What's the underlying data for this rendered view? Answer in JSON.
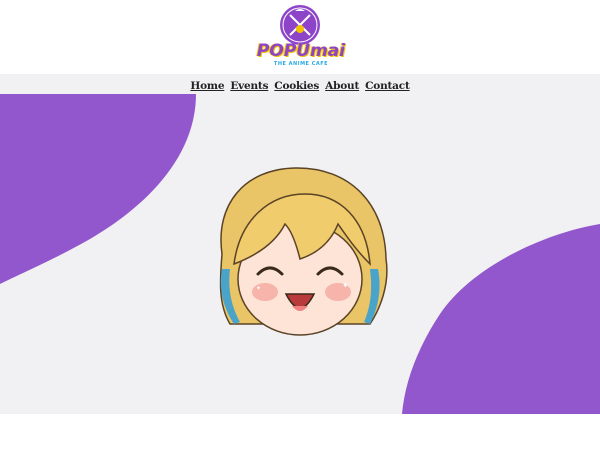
{
  "brand": {
    "name": "POPUmai",
    "tagline": "THE ANIME CAFE",
    "colors": {
      "purple": "#8e44c8",
      "yellow": "#f2c200",
      "blue": "#2aa8e0"
    }
  },
  "nav": {
    "items": [
      {
        "label": "Home"
      },
      {
        "label": "Events"
      },
      {
        "label": "Cookies"
      },
      {
        "label": "About"
      },
      {
        "label": "Contact"
      }
    ]
  },
  "hero": {
    "background": "#f1f0f3",
    "blob_color": "#9257cc",
    "mascot": "anime-girl-mascot-laughing"
  }
}
